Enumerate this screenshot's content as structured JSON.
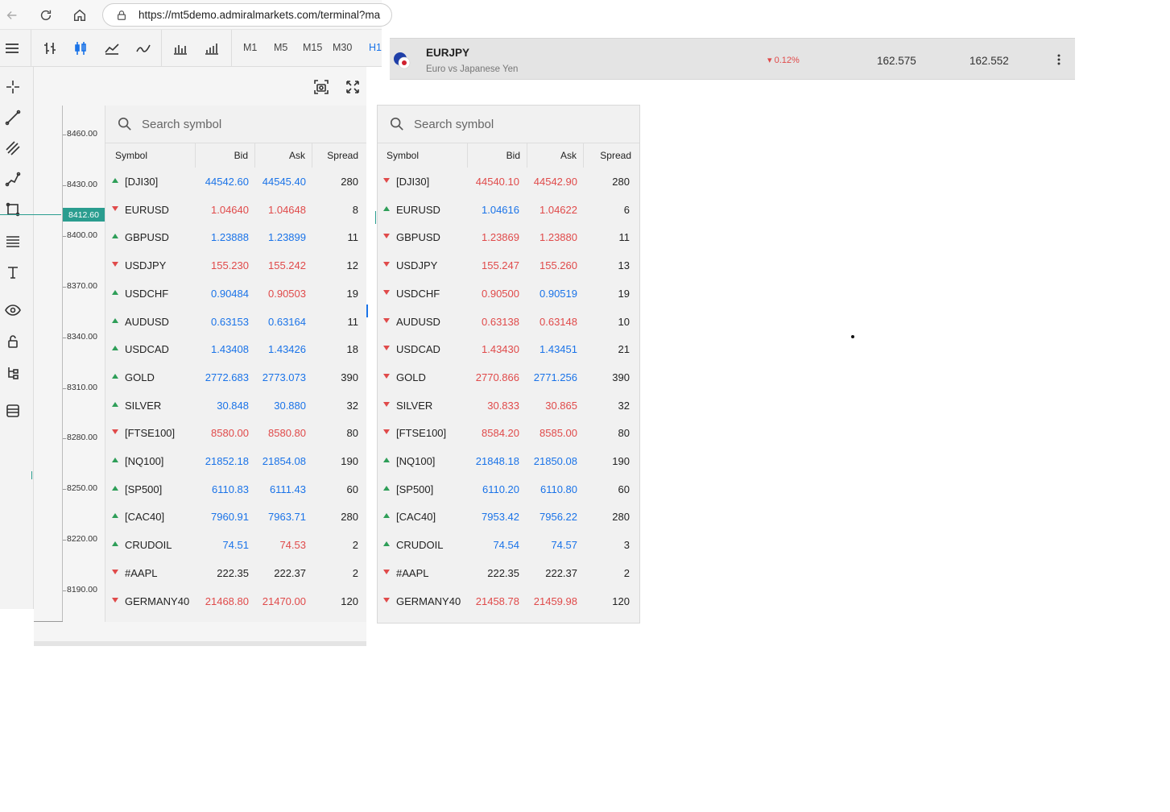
{
  "browser": {
    "url": "https://mt5demo.admiralmarkets.com/terminal?ma"
  },
  "toolbar": {
    "timeframes": [
      "M1",
      "M5",
      "M15",
      "M30",
      "H1"
    ],
    "active_timeframe": "H1"
  },
  "chart": {
    "y_labels": [
      "8460.00",
      "8430.00",
      "8400.00",
      "8370.00",
      "8340.00",
      "8310.00",
      "8280.00",
      "8250.00",
      "8220.00",
      "8190.00"
    ],
    "current_price": "8412.60",
    "accent": "#2a9d8f"
  },
  "symbol_strip": {
    "name": "EURJPY",
    "description": "Euro vs Japanese Yen",
    "change": "0.12%",
    "bid": "162.575",
    "ask": "162.552"
  },
  "colors": {
    "up": "#1a73e8",
    "down": "#e04a4a",
    "neutral": "#222222",
    "up_arrow": "#2e9e58",
    "down_arrow": "#e04a4a"
  },
  "market_watch_left": {
    "search_placeholder": "Search symbol",
    "columns": [
      "Symbol",
      "Bid",
      "Ask",
      "Spread"
    ],
    "rows": [
      {
        "dir": "up",
        "symbol": "[DJI30]",
        "bid": "44542.60",
        "ask": "44545.40",
        "spread": "280",
        "bid_c": "up",
        "ask_c": "up"
      },
      {
        "dir": "down",
        "symbol": "EURUSD",
        "bid": "1.04640",
        "ask": "1.04648",
        "spread": "8",
        "bid_c": "down",
        "ask_c": "down"
      },
      {
        "dir": "up",
        "symbol": "GBPUSD",
        "bid": "1.23888",
        "ask": "1.23899",
        "spread": "11",
        "bid_c": "up",
        "ask_c": "up"
      },
      {
        "dir": "down",
        "symbol": "USDJPY",
        "bid": "155.230",
        "ask": "155.242",
        "spread": "12",
        "bid_c": "down",
        "ask_c": "down"
      },
      {
        "dir": "up",
        "symbol": "USDCHF",
        "bid": "0.90484",
        "ask": "0.90503",
        "spread": "19",
        "bid_c": "up",
        "ask_c": "down"
      },
      {
        "dir": "up",
        "symbol": "AUDUSD",
        "bid": "0.63153",
        "ask": "0.63164",
        "spread": "11",
        "bid_c": "up",
        "ask_c": "up"
      },
      {
        "dir": "up",
        "symbol": "USDCAD",
        "bid": "1.43408",
        "ask": "1.43426",
        "spread": "18",
        "bid_c": "up",
        "ask_c": "up"
      },
      {
        "dir": "up",
        "symbol": "GOLD",
        "bid": "2772.683",
        "ask": "2773.073",
        "spread": "390",
        "bid_c": "up",
        "ask_c": "up"
      },
      {
        "dir": "up",
        "symbol": "SILVER",
        "bid": "30.848",
        "ask": "30.880",
        "spread": "32",
        "bid_c": "up",
        "ask_c": "up"
      },
      {
        "dir": "down",
        "symbol": "[FTSE100]",
        "bid": "8580.00",
        "ask": "8580.80",
        "spread": "80",
        "bid_c": "down",
        "ask_c": "down"
      },
      {
        "dir": "up",
        "symbol": "[NQ100]",
        "bid": "21852.18",
        "ask": "21854.08",
        "spread": "190",
        "bid_c": "up",
        "ask_c": "up"
      },
      {
        "dir": "up",
        "symbol": "[SP500]",
        "bid": "6110.83",
        "ask": "6111.43",
        "spread": "60",
        "bid_c": "up",
        "ask_c": "up"
      },
      {
        "dir": "up",
        "symbol": "[CAC40]",
        "bid": "7960.91",
        "ask": "7963.71",
        "spread": "280",
        "bid_c": "up",
        "ask_c": "up"
      },
      {
        "dir": "up",
        "symbol": "CRUDOIL",
        "bid": "74.51",
        "ask": "74.53",
        "spread": "2",
        "bid_c": "up",
        "ask_c": "down"
      },
      {
        "dir": "down",
        "symbol": "#AAPL",
        "bid": "222.35",
        "ask": "222.37",
        "spread": "2",
        "bid_c": "neutral",
        "ask_c": "neutral"
      },
      {
        "dir": "down",
        "symbol": "GERMANY40",
        "bid": "21468.80",
        "ask": "21470.00",
        "spread": "120",
        "bid_c": "down",
        "ask_c": "down"
      }
    ]
  },
  "market_watch_right": {
    "search_placeholder": "Search symbol",
    "columns": [
      "Symbol",
      "Bid",
      "Ask",
      "Spread"
    ],
    "rows": [
      {
        "dir": "down",
        "symbol": "[DJI30]",
        "bid": "44540.10",
        "ask": "44542.90",
        "spread": "280",
        "bid_c": "down",
        "ask_c": "down"
      },
      {
        "dir": "up",
        "symbol": "EURUSD",
        "bid": "1.04616",
        "ask": "1.04622",
        "spread": "6",
        "bid_c": "up",
        "ask_c": "down"
      },
      {
        "dir": "down",
        "symbol": "GBPUSD",
        "bid": "1.23869",
        "ask": "1.23880",
        "spread": "11",
        "bid_c": "down",
        "ask_c": "down"
      },
      {
        "dir": "down",
        "symbol": "USDJPY",
        "bid": "155.247",
        "ask": "155.260",
        "spread": "13",
        "bid_c": "down",
        "ask_c": "down"
      },
      {
        "dir": "down",
        "symbol": "USDCHF",
        "bid": "0.90500",
        "ask": "0.90519",
        "spread": "19",
        "bid_c": "down",
        "ask_c": "up"
      },
      {
        "dir": "down",
        "symbol": "AUDUSD",
        "bid": "0.63138",
        "ask": "0.63148",
        "spread": "10",
        "bid_c": "down",
        "ask_c": "down"
      },
      {
        "dir": "down",
        "symbol": "USDCAD",
        "bid": "1.43430",
        "ask": "1.43451",
        "spread": "21",
        "bid_c": "down",
        "ask_c": "up"
      },
      {
        "dir": "down",
        "symbol": "GOLD",
        "bid": "2770.866",
        "ask": "2771.256",
        "spread": "390",
        "bid_c": "down",
        "ask_c": "up"
      },
      {
        "dir": "down",
        "symbol": "SILVER",
        "bid": "30.833",
        "ask": "30.865",
        "spread": "32",
        "bid_c": "down",
        "ask_c": "down"
      },
      {
        "dir": "down",
        "symbol": "[FTSE100]",
        "bid": "8584.20",
        "ask": "8585.00",
        "spread": "80",
        "bid_c": "down",
        "ask_c": "down"
      },
      {
        "dir": "up",
        "symbol": "[NQ100]",
        "bid": "21848.18",
        "ask": "21850.08",
        "spread": "190",
        "bid_c": "up",
        "ask_c": "up"
      },
      {
        "dir": "up",
        "symbol": "[SP500]",
        "bid": "6110.20",
        "ask": "6110.80",
        "spread": "60",
        "bid_c": "up",
        "ask_c": "up"
      },
      {
        "dir": "up",
        "symbol": "[CAC40]",
        "bid": "7953.42",
        "ask": "7956.22",
        "spread": "280",
        "bid_c": "up",
        "ask_c": "up"
      },
      {
        "dir": "up",
        "symbol": "CRUDOIL",
        "bid": "74.54",
        "ask": "74.57",
        "spread": "3",
        "bid_c": "up",
        "ask_c": "up"
      },
      {
        "dir": "down",
        "symbol": "#AAPL",
        "bid": "222.35",
        "ask": "222.37",
        "spread": "2",
        "bid_c": "neutral",
        "ask_c": "neutral"
      },
      {
        "dir": "down",
        "symbol": "GERMANY40",
        "bid": "21458.78",
        "ask": "21459.98",
        "spread": "120",
        "bid_c": "down",
        "ask_c": "down"
      }
    ]
  }
}
